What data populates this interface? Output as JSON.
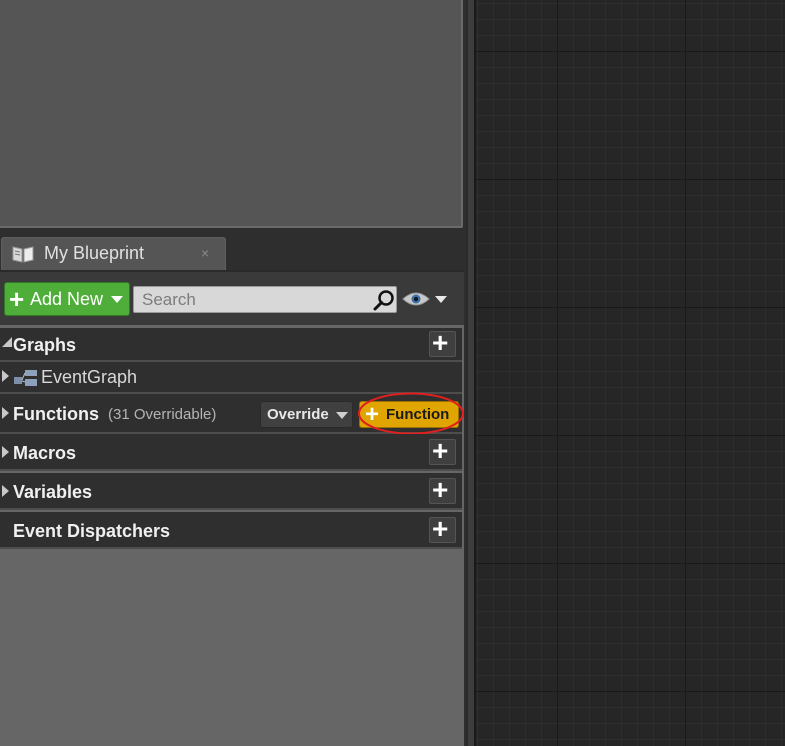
{
  "tab": {
    "label": "My Blueprint",
    "close_glyph": "×",
    "icon": "book-icon"
  },
  "toolbar": {
    "add_new_label": "Add New",
    "search_placeholder": "Search",
    "search_icon": "search-icon",
    "view_icon": "eye-icon"
  },
  "categories": {
    "graphs": {
      "label": "Graphs",
      "items": [
        {
          "label": "EventGraph",
          "icon": "event-graph-icon"
        }
      ]
    },
    "functions": {
      "label": "Functions",
      "count_text": "(31 Overridable)",
      "override_label": "Override",
      "add_function_label": "Function"
    },
    "macros": {
      "label": "Macros"
    },
    "variables": {
      "label": "Variables"
    },
    "event_dispatchers": {
      "label": "Event Dispatchers"
    }
  },
  "colors": {
    "add_new": "#4fae3a",
    "add_function": "#e0a500",
    "annotation_circle": "#e0201e",
    "graph_background": "#262626"
  }
}
